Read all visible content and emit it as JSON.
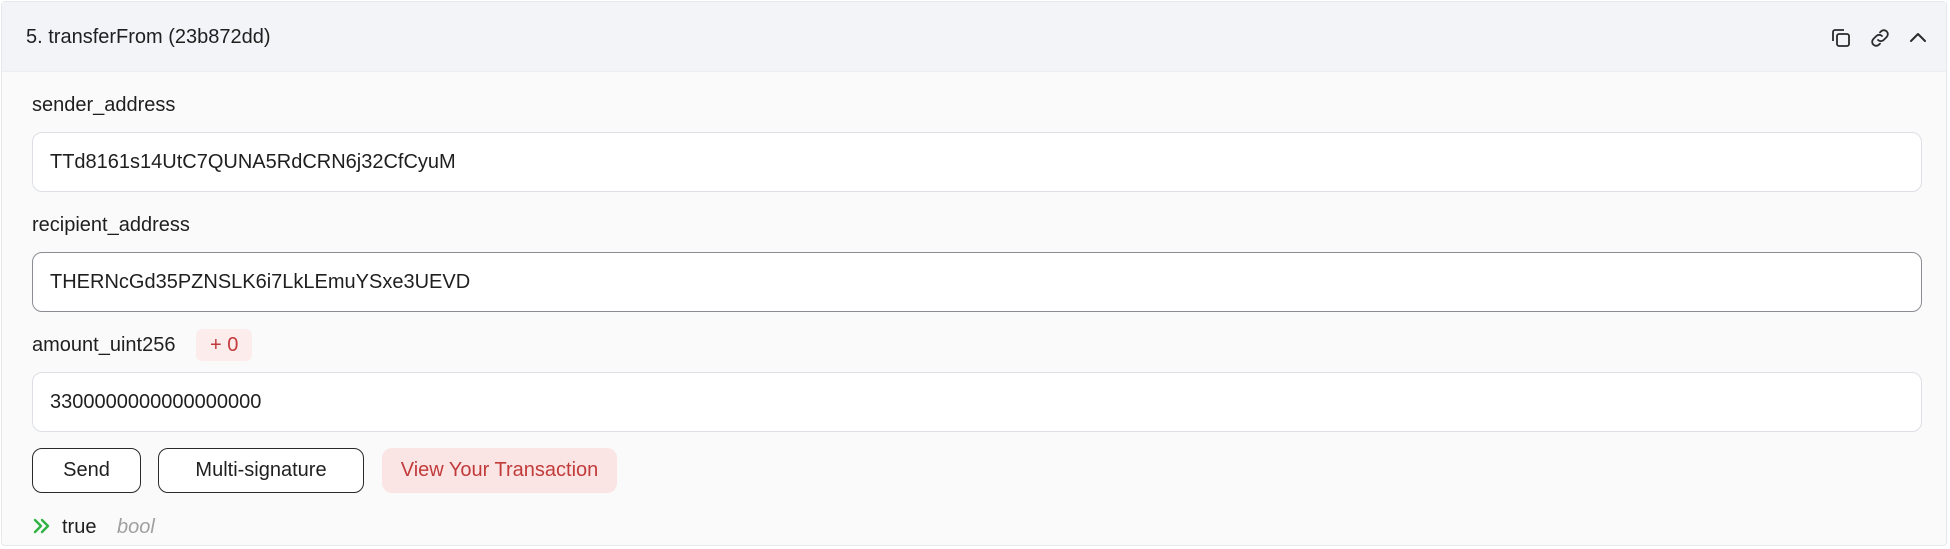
{
  "header": {
    "title": "5. transferFrom (23b872dd)",
    "icons": [
      "copy-icon",
      "link-icon",
      "chevron-up-icon"
    ]
  },
  "fields": {
    "sender": {
      "label": "sender_address",
      "value": "TTd8161s14UtC7QUNA5RdCRN6j32CfCyuM"
    },
    "recipient": {
      "label": "recipient_address",
      "value": "THERNcGd35PZNSLK6i7LkLEmuYSxe3UEVD"
    },
    "amount": {
      "label": "amount_uint256",
      "badge": "+ 0",
      "value": "3300000000000000000"
    }
  },
  "buttons": {
    "send": "Send",
    "multisig": "Multi-signature",
    "view_tx": "View Your Transaction"
  },
  "result": {
    "icon": "double-chevron-right-icon",
    "value": "true",
    "type": "bool"
  },
  "colors": {
    "accent_red": "#c23b3b",
    "badge_bg": "#fdecec",
    "result_green": "#2fb344",
    "header_bg": "#f2f4f8"
  }
}
